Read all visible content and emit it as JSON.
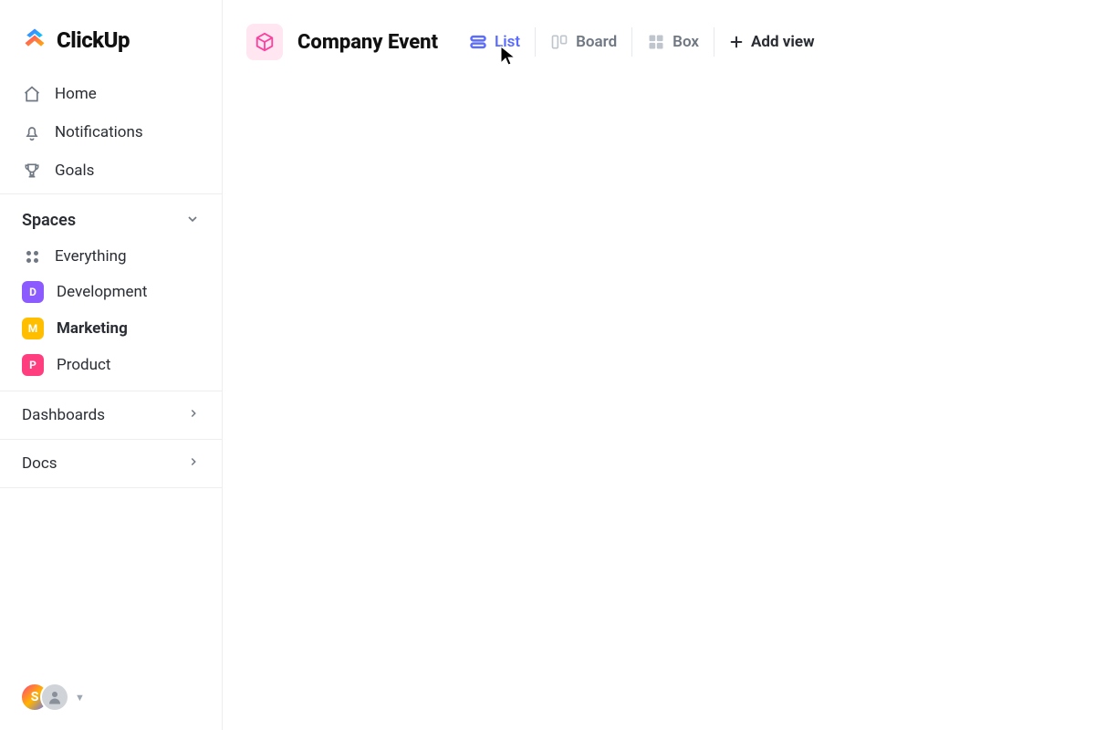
{
  "brand": "ClickUp",
  "sidebar": {
    "nav": [
      {
        "label": "Home",
        "icon": "home-icon"
      },
      {
        "label": "Notifications",
        "icon": "bell-icon"
      },
      {
        "label": "Goals",
        "icon": "trophy-icon"
      }
    ],
    "spaces_label": "Spaces",
    "everything_label": "Everything",
    "spaces": [
      {
        "letter": "D",
        "label": "Development",
        "color": "#8c5bff",
        "active": false
      },
      {
        "letter": "M",
        "label": "Marketing",
        "color": "#ffbf00",
        "active": true
      },
      {
        "letter": "P",
        "label": "Product",
        "color": "#ff3e7f",
        "active": false
      }
    ],
    "dashboards_label": "Dashboards",
    "docs_label": "Docs",
    "avatar_letter": "S"
  },
  "header": {
    "title": "Company Event",
    "tabs": [
      {
        "label": "List",
        "icon": "list-icon",
        "active": true
      },
      {
        "label": "Board",
        "icon": "board-icon",
        "active": false
      },
      {
        "label": "Box",
        "icon": "box-icon",
        "active": false
      }
    ],
    "add_view_label": "Add view"
  }
}
